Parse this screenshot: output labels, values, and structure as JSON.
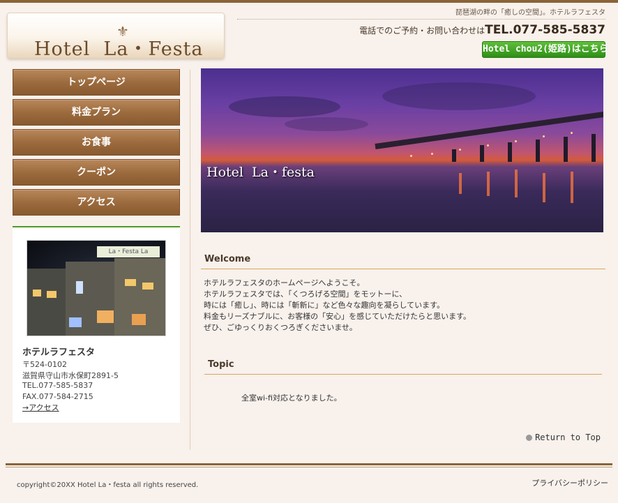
{
  "header": {
    "logo_fleur": "⚜",
    "logo_text": "Hotel  La・Festa",
    "tagline": "琵琶湖の畔の「癒しの空間」。ホテルラフェスタ",
    "tel_prefix": "電話でのご予約・お問い合わせは",
    "tel_number": "TEL.077-585-5837",
    "chou_button": "Hotel chou2(姫路)はこちら"
  },
  "nav": {
    "items": [
      {
        "label": "トップページ"
      },
      {
        "label": "料金プラン"
      },
      {
        "label": "お食事"
      },
      {
        "label": "クーポン"
      },
      {
        "label": "アクセス"
      }
    ]
  },
  "info": {
    "photo_sign": "La・Festa La",
    "name": "ホテルラフェスタ",
    "postal": "〒524-0102",
    "address": "滋賀県守山市水保町2891-5",
    "tel": "TEL.077-585-5837",
    "fax": "FAX.077-584-2715",
    "access_link": "→アクセス"
  },
  "hero": {
    "title": "Hotel  La・festa"
  },
  "welcome": {
    "heading": "Welcome",
    "lines": [
      "ホテルラフェスタのホームページへようこそ。",
      "ホテルラフェスタでは、「くつろげる空間」をモットーに、",
      "時には「癒し」、時には「斬新に」など色々な趣向を凝らしています。",
      "料金もリーズナブルに、お客様の「安心」を感じていただけたらと思います。",
      "ぜひ、ごゆっくりおくつろぎくださいませ。"
    ]
  },
  "topic": {
    "heading": "Topic",
    "text": "全室wi-fi対応となりました。"
  },
  "return_top": "Return to Top",
  "footer": {
    "copyright": "copyright©20XX Hotel La・festa all rights reserved.",
    "privacy": "プライバシーポリシー"
  }
}
